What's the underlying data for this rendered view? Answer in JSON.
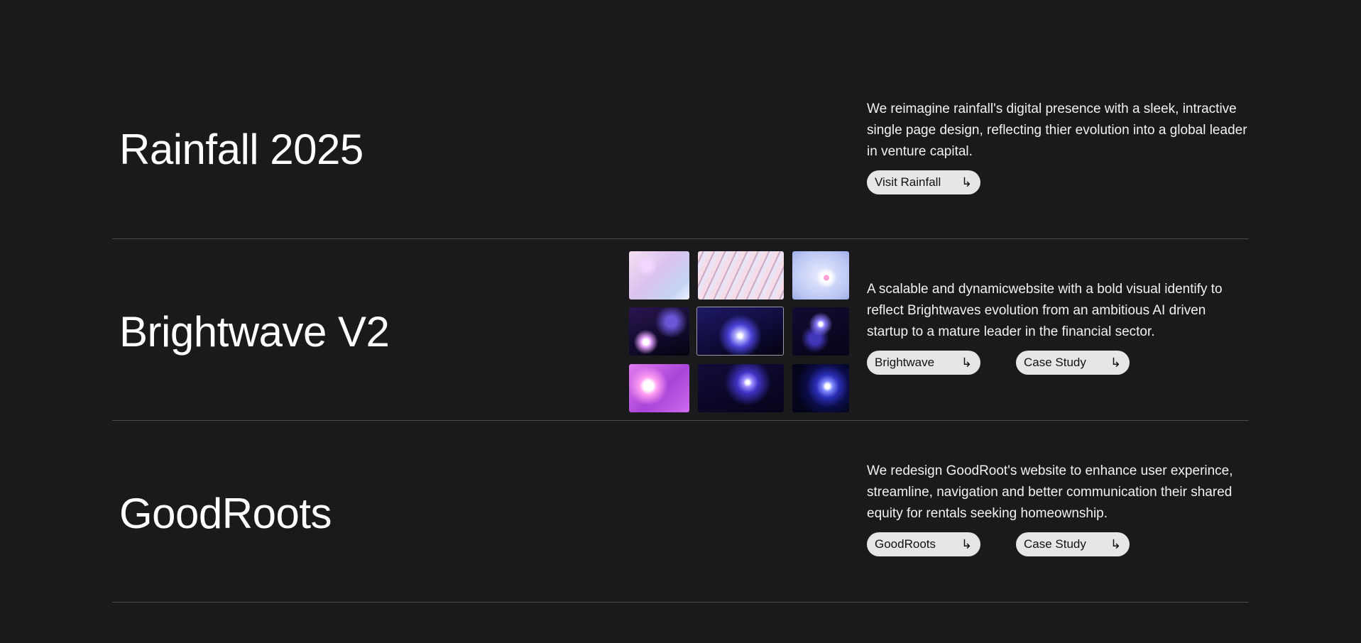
{
  "projects": [
    {
      "title": "Rainfall 2025",
      "description": "We reimagine rainfall's digital presence with a sleek, intractive single page design, reflecting thier evolution into a global leader in venture capital.",
      "buttons": [
        {
          "label": "Visit Rainfall",
          "icon": "hook-arrow-right-icon"
        }
      ]
    },
    {
      "title": "Brightwave V2",
      "description": "A scalable and dynamicwebsite with a bold visual identify to reflect Brightwaves evolution from an ambitious AI driven startup to a mature leader in the financial sector.",
      "buttons": [
        {
          "label": "Brightwave",
          "icon": "hook-arrow-right-icon"
        },
        {
          "label": "Case Study",
          "icon": "hook-arrow-right-icon"
        }
      ]
    },
    {
      "title": "GoodRoots",
      "description": "We redesign GoodRoot's website to enhance user experince, streamline, navigation and better communication their shared equity for rentals seeking homeownship.",
      "buttons": [
        {
          "label": "GoodRoots",
          "icon": "hook-arrow-right-icon"
        },
        {
          "label": "Case Study",
          "icon": "hook-arrow-right-icon"
        }
      ]
    }
  ],
  "arrow_glyph": "↳",
  "colors": {
    "background": "#1a1a1c",
    "text": "#ffffff",
    "pill_bg": "#e6e6e8",
    "pill_text": "#111111",
    "divider": "#4a4a4d"
  }
}
